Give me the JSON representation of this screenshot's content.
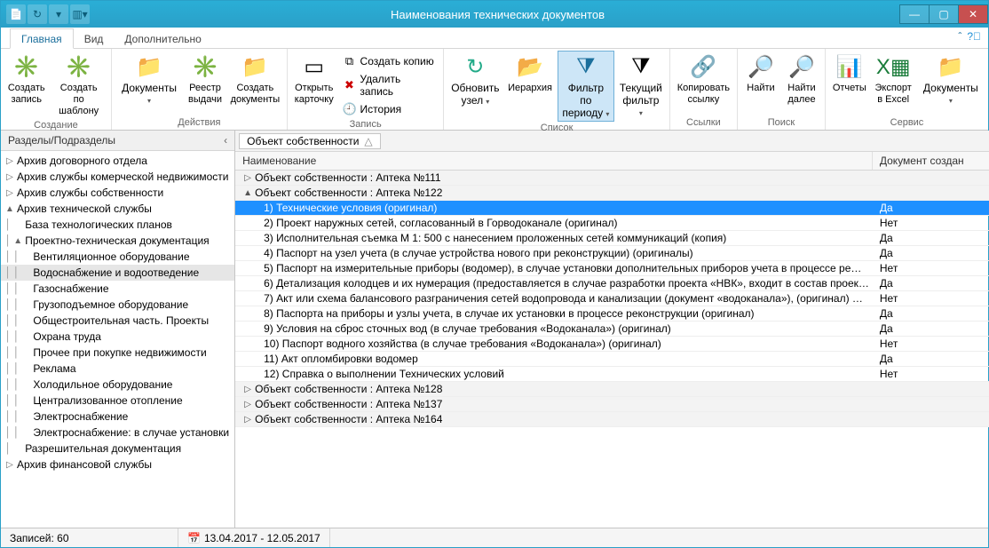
{
  "title": "Наименования технических документов",
  "tabs": {
    "main": "Главная",
    "view": "Вид",
    "extra": "Дополнительно"
  },
  "ribbon": {
    "groups": {
      "create": {
        "title": "Создание",
        "new": "Создать\nзапись",
        "tpl": "Создать по\nшаблону"
      },
      "actions": {
        "title": "Действия",
        "docs": "Документы",
        "registry": "Реестр\nвыдачи",
        "createdocs": "Создать\nдокументы"
      },
      "record": {
        "title": "Запись",
        "open": "Открыть\nкарточку",
        "copy": "Создать копию",
        "delete": "Удалить запись",
        "history": "История"
      },
      "list": {
        "title": "Список",
        "refresh": "Обновить\nузел",
        "hierarchy": "Иерархия",
        "filterperiod": "Фильтр по\nпериоду",
        "currentfilter": "Текущий\nфильтр"
      },
      "links": {
        "title": "Ссылки",
        "copylink": "Копировать\nссылку"
      },
      "search": {
        "title": "Поиск",
        "find": "Найти",
        "findnext": "Найти\nдалее"
      },
      "service": {
        "title": "Сервис",
        "reports": "Отчеты",
        "excel": "Экспорт\nв Excel",
        "docs": "Документы"
      }
    }
  },
  "sidebar": {
    "header": "Разделы/Подразделы",
    "items": [
      {
        "exp": "▷",
        "depth": 0,
        "label": "Архив договорного отдела"
      },
      {
        "exp": "▷",
        "depth": 0,
        "label": "Архив службы комерческой недвижимости"
      },
      {
        "exp": "▷",
        "depth": 0,
        "label": "Архив службы собственности"
      },
      {
        "exp": "▲",
        "depth": 0,
        "label": "Архив технической службы"
      },
      {
        "exp": "",
        "depth": 1,
        "label": "База технологических планов"
      },
      {
        "exp": "▲",
        "depth": 1,
        "label": "Проектно-техническая документация"
      },
      {
        "exp": "",
        "depth": 2,
        "label": "Вентиляционное оборудование"
      },
      {
        "exp": "",
        "depth": 2,
        "label": "Водоснабжение и водоотведение",
        "sel": true
      },
      {
        "exp": "",
        "depth": 2,
        "label": "Газоснабжение"
      },
      {
        "exp": "",
        "depth": 2,
        "label": "Грузоподъемное оборудование"
      },
      {
        "exp": "",
        "depth": 2,
        "label": "Общестроительная часть. Проекты"
      },
      {
        "exp": "",
        "depth": 2,
        "label": "Охрана труда"
      },
      {
        "exp": "",
        "depth": 2,
        "label": "Прочее при покупке недвижимости"
      },
      {
        "exp": "",
        "depth": 2,
        "label": "Реклама"
      },
      {
        "exp": "",
        "depth": 2,
        "label": "Холодильное оборудование"
      },
      {
        "exp": "",
        "depth": 2,
        "label": "Централизованное отопление"
      },
      {
        "exp": "",
        "depth": 2,
        "label": "Электроснабжение"
      },
      {
        "exp": "",
        "depth": 2,
        "label": "Электроснабжение: в случае установки"
      },
      {
        "exp": "",
        "depth": 1,
        "label": "Разрешительная документация"
      },
      {
        "exp": "▷",
        "depth": 0,
        "label": "Архив финансовой службы"
      }
    ]
  },
  "grid": {
    "groupby": "Объект собственности",
    "columns": {
      "name": "Наименование",
      "created": "Документ создан"
    },
    "rows": [
      {
        "type": "group",
        "exp": "▷",
        "label": "Объект собственности : Аптека №111"
      },
      {
        "type": "group",
        "exp": "▲",
        "label": "Объект собственности : Аптека №122"
      },
      {
        "type": "row",
        "sel": true,
        "name": "1) Технические условия (оригинал)",
        "created": "Да"
      },
      {
        "type": "row",
        "name": "2) Проект наружных сетей, согласованный в Горводоканале (оригинал)",
        "created": "Нет"
      },
      {
        "type": "row",
        "name": "3) Исполнительная съемка М 1: 500 с нанесением проложенных  сетей коммуникаций (копия)",
        "created": "Да"
      },
      {
        "type": "row",
        "name": "4) Паспорт на узел учета (в случае устройства нового при реконструкции) (оригиналы)",
        "created": "Да"
      },
      {
        "type": "row",
        "name": "5) Паспорт на измерительные приборы (водомер), в случае установки дополнительных приборов учета в процессе ре…",
        "created": "Нет"
      },
      {
        "type": "row",
        "name": "6) Детализация колодцев и их нумерация (предоставляется в случае разработки проекта «НВК», входит в состав проек…",
        "created": "Да"
      },
      {
        "type": "row",
        "name": "7) Акт или схема балансового разграничения сетей водопровода и канализации (документ «водоканала»), (оригинал) …",
        "created": "Нет"
      },
      {
        "type": "row",
        "name": "8) Паспорта на приборы и узлы учета, в случае их установки в процессе реконструкции (оригинал)",
        "created": "Да"
      },
      {
        "type": "row",
        "name": "9) Условия на сброс сточных вод (в случае требования «Водоканала») (оригинал)",
        "created": "Да"
      },
      {
        "type": "row",
        "name": "10) Паспорт водного хозяйства (в случае требования «Водоканала») (оригинал)",
        "created": "Нет"
      },
      {
        "type": "row",
        "name": "11) Акт опломбировки водомер",
        "created": "Да"
      },
      {
        "type": "row",
        "name": "12) Справка о выполнении Технических условий",
        "created": "Нет"
      },
      {
        "type": "group",
        "exp": "▷",
        "label": "Объект собственности : Аптека №128"
      },
      {
        "type": "group",
        "exp": "▷",
        "label": "Объект собственности : Аптека №137"
      },
      {
        "type": "group",
        "exp": "▷",
        "label": "Объект собственности : Аптека №164"
      }
    ]
  },
  "status": {
    "records": "Записей: 60",
    "period": "13.04.2017 - 12.05.2017"
  }
}
